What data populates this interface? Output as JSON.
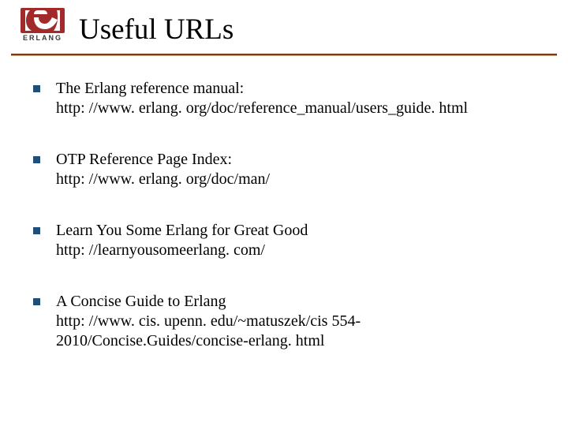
{
  "logo": {
    "text": "ERLANG"
  },
  "title": "Useful URLs",
  "items": [
    {
      "label": "The Erlang reference manual:",
      "url": "http: //www. erlang. org/doc/reference_manual/users_guide. html"
    },
    {
      "label": "OTP Reference Page Index:",
      "url": "http: //www. erlang. org/doc/man/"
    },
    {
      "label": "Learn You Some Erlang for Great Good",
      "url": "http: //learnyousomeerlang. com/"
    },
    {
      "label": "A Concise Guide to Erlang",
      "url": "http: //www. cis. upenn. edu/~matuszek/cis 554-2010/Concise.Guides/concise-erlang. html"
    }
  ]
}
